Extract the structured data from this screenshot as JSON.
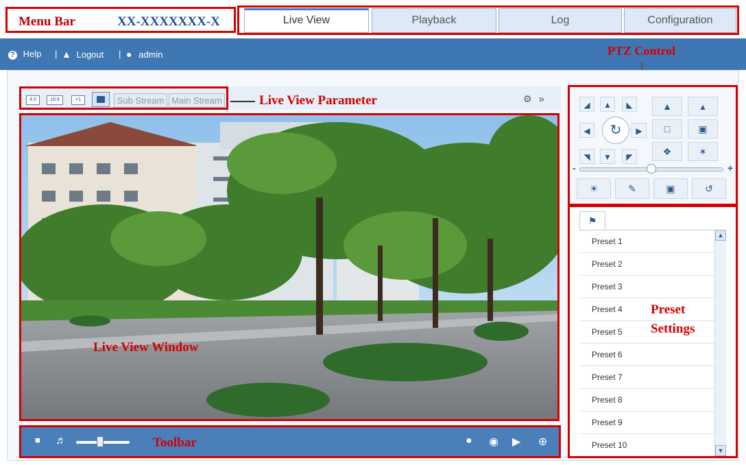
{
  "menubar": {
    "annotation": "Menu Bar",
    "model": "XX-XXXXXXX-X",
    "tabs": [
      {
        "label": "Live View"
      },
      {
        "label": "Playback"
      },
      {
        "label": "Log"
      },
      {
        "label": "Configuration"
      }
    ]
  },
  "infobar": {
    "help": "Help",
    "logout": "Logout",
    "user": "admin",
    "separator": "|"
  },
  "annotations": {
    "ptz": "PTZ Control",
    "live_view_parameter": "Live View Parameter",
    "live_view_window": "Live View Window",
    "toolbar": "Toolbar",
    "preset_settings_line1": "Preset",
    "preset_settings_line2": "Settings"
  },
  "params": {
    "ratio_4_3": "4:3",
    "ratio_16_9": "16:9",
    "ratio_x1": "×1",
    "sub_stream": "Sub Stream",
    "main_stream": "Main Stream",
    "expand": "»"
  },
  "toolbar": {
    "volume_level": 0.45
  },
  "ptz": {
    "speed_level": 0.5
  },
  "presets": [
    "Preset 1",
    "Preset 2",
    "Preset 3",
    "Preset 4",
    "Preset 5",
    "Preset 6",
    "Preset 7",
    "Preset 8",
    "Preset 9",
    "Preset 10"
  ],
  "colors": {
    "accent": "#3f77b4",
    "annotation": "#d40000"
  }
}
